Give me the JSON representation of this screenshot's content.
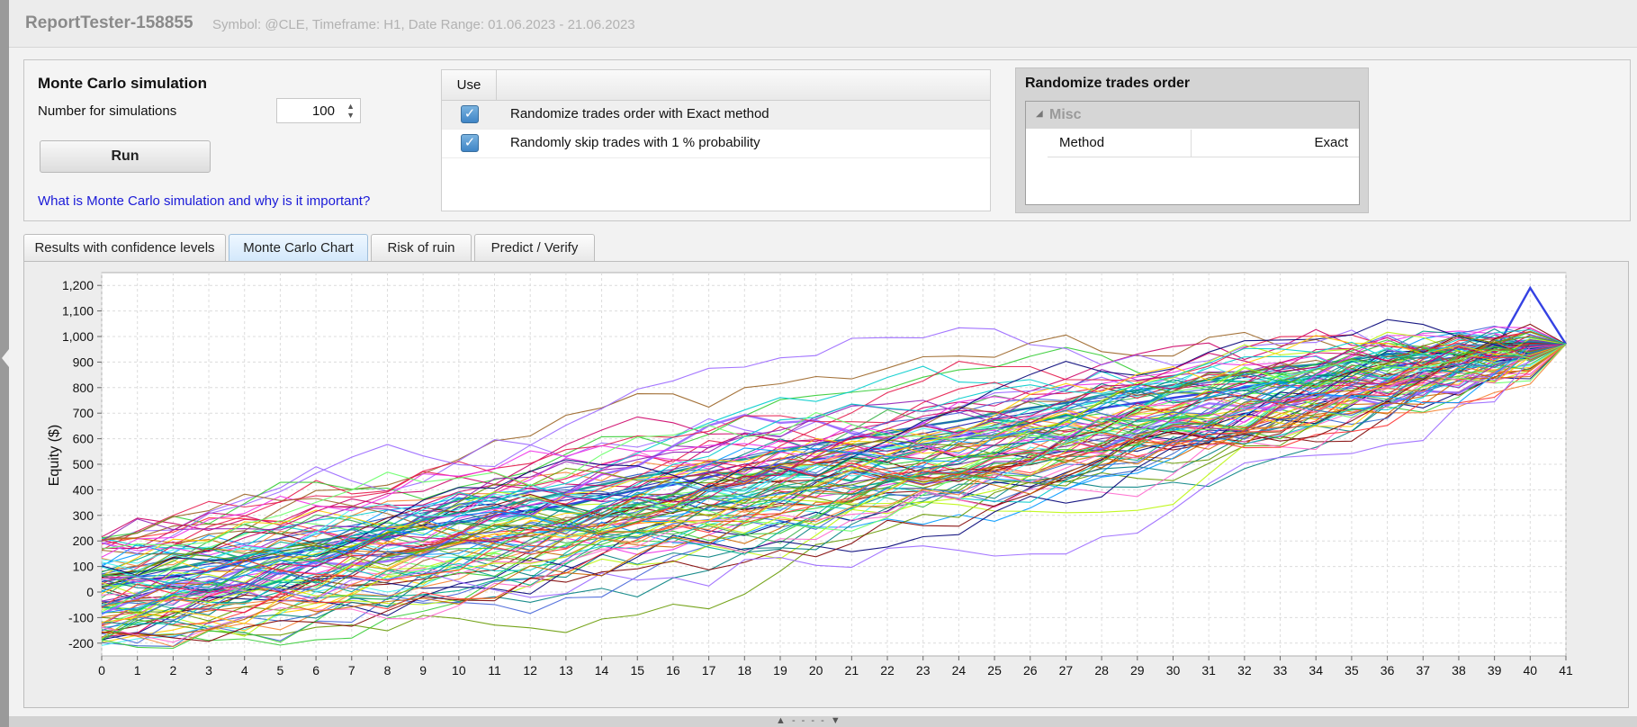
{
  "header": {
    "title": "ReportTester-158855",
    "subtitle": "Symbol: @CLE, Timeframe: H1, Date Range: 01.06.2023 - 21.06.2023"
  },
  "simulation": {
    "title": "Monte Carlo simulation",
    "count_label": "Number for simulations",
    "count_value": "100",
    "run_label": "Run",
    "help_link": "What is Monte Carlo simulation and why is it important?"
  },
  "options": {
    "header_use": "Use",
    "rows": [
      {
        "label": "Randomize trades order with Exact method",
        "checked": true
      },
      {
        "label": "Randomly skip trades with 1 % probability",
        "checked": true
      }
    ]
  },
  "properties": {
    "title": "Randomize trades order",
    "group": "Misc",
    "method_label": "Method",
    "method_value": "Exact"
  },
  "tabs": [
    {
      "label": "Results with confidence levels",
      "active": false
    },
    {
      "label": "Monte Carlo Chart",
      "active": true
    },
    {
      "label": "Risk of ruin",
      "active": false
    },
    {
      "label": "Predict / Verify",
      "active": false
    }
  ],
  "glyphs": {
    "check": "✓",
    "spin_up": "▲",
    "spin_down": "▼",
    "tree_arrow": "◢",
    "collapse": "▲ - - - - ▼"
  },
  "chart_data": {
    "type": "line",
    "xlabel": "",
    "ylabel": "Equity ($)",
    "xlim": [
      0,
      41
    ],
    "ylim": [
      -250,
      1250
    ],
    "x_ticks": [
      0,
      1,
      2,
      3,
      4,
      5,
      6,
      7,
      8,
      9,
      10,
      11,
      12,
      13,
      14,
      15,
      16,
      17,
      18,
      19,
      20,
      21,
      22,
      23,
      24,
      25,
      26,
      27,
      28,
      29,
      30,
      31,
      32,
      33,
      34,
      35,
      36,
      37,
      38,
      39,
      40,
      41
    ],
    "y_ticks": [
      -200,
      -100,
      0,
      100,
      200,
      300,
      400,
      500,
      600,
      700,
      800,
      900,
      1000,
      1100,
      1200
    ],
    "y_tick_labels": [
      "-200",
      "-100",
      "0",
      "100",
      "200",
      "300",
      "400",
      "500",
      "600",
      "700",
      "800",
      "900",
      "1,000",
      "1,100",
      "1,200"
    ],
    "grid": true,
    "series_count": 100,
    "x_values": "0-41 (trade number)",
    "start_range": [
      -210,
      230
    ],
    "end_value": 970,
    "series": [
      {
        "values": [
          20,
          40,
          60,
          80,
          120,
          140,
          170,
          200,
          210,
          250,
          270,
          300,
          320,
          340,
          370,
          400,
          420,
          450,
          480,
          500,
          520,
          540,
          570,
          600,
          610,
          640,
          660,
          690,
          720,
          740,
          760,
          780,
          800,
          820,
          840,
          860,
          880,
          900,
          920,
          940,
          1190,
          970
        ]
      },
      {
        "values": [
          40,
          60,
          90,
          110,
          130,
          160,
          180,
          210,
          230,
          260,
          280,
          310,
          340,
          360,
          380,
          410,
          440,
          470,
          500,
          520,
          550,
          570,
          600,
          620,
          650,
          680,
          700,
          730,
          750,
          770,
          800,
          820,
          840,
          860,
          880,
          900,
          920,
          940,
          950,
          960,
          960,
          970
        ]
      },
      {
        "values": [
          60,
          80,
          90,
          120,
          140,
          170,
          200,
          220,
          250,
          280,
          310,
          330,
          360,
          390,
          420,
          450,
          470,
          500,
          520,
          550,
          580,
          600,
          620,
          650,
          670,
          700,
          720,
          740,
          770,
          790,
          810,
          830,
          860,
          880,
          890,
          910,
          930,
          940,
          950,
          960,
          965,
          970
        ]
      },
      {
        "values": [
          30,
          50,
          60,
          80,
          90,
          110,
          120,
          140,
          150,
          170,
          190,
          210,
          220,
          250,
          270,
          290,
          310,
          340,
          360,
          390,
          400,
          430,
          450,
          480,
          500,
          530,
          550,
          570,
          600,
          620,
          640,
          670,
          700,
          720,
          750,
          770,
          800,
          830,
          860,
          900,
          940,
          970
        ]
      },
      {
        "values": [
          70,
          100,
          130,
          160,
          190,
          210,
          240,
          260,
          290,
          310,
          340,
          360,
          390,
          410,
          430,
          460,
          480,
          510,
          530,
          560,
          580,
          600,
          630,
          650,
          670,
          690,
          720,
          740,
          760,
          780,
          810,
          830,
          850,
          870,
          890,
          910,
          930,
          950,
          960,
          965,
          968,
          970
        ]
      }
    ]
  }
}
